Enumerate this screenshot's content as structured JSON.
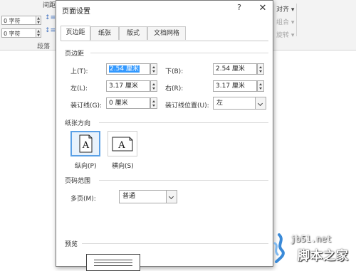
{
  "ribbon": {
    "spacing_label": "间距",
    "indent_left_value": "0 字符",
    "indent_right_value": "0 字符",
    "group_label": "段落",
    "right_items": [
      "对齐",
      "组合",
      "旋转"
    ]
  },
  "dialog": {
    "title": "页面设置",
    "help": "?",
    "close": "✕",
    "tabs": [
      "页边距",
      "纸张",
      "版式",
      "文档网格"
    ],
    "margins": {
      "section_title": "页边距",
      "top_label": "上(T):",
      "top_value": "2.54 厘米",
      "bottom_label": "下(B):",
      "bottom_value": "2.54 厘米",
      "left_label": "左(L):",
      "left_value": "3.17 厘米",
      "right_label": "右(R):",
      "right_value": "3.17 厘米",
      "gutter_label": "装订线(G):",
      "gutter_value": "0 厘米",
      "gutter_pos_label": "装订线位置(U):",
      "gutter_pos_value": "左"
    },
    "orientation": {
      "section_title": "纸张方向",
      "portrait_label": "纵向(P)",
      "landscape_label": "横向(S)",
      "selected": "portrait"
    },
    "pages": {
      "section_title": "页码范围",
      "multiple_label": "多页(M):",
      "multiple_value": "普通"
    },
    "preview": {
      "section_title": "预览"
    }
  },
  "watermark": {
    "url": "jb51.net",
    "name": "脚本之家"
  }
}
